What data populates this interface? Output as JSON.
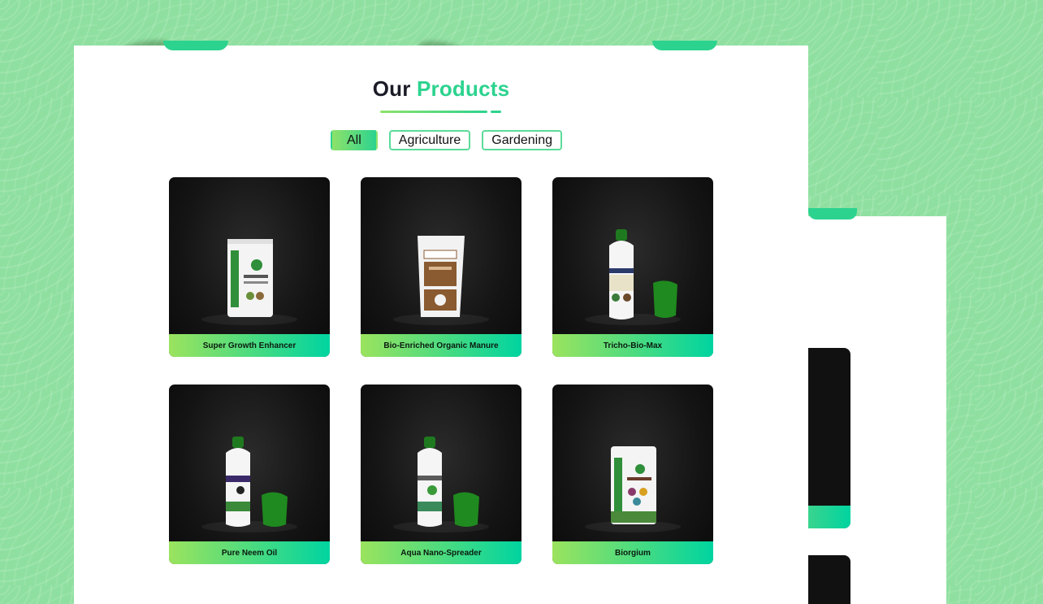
{
  "section": {
    "title_main": "Our",
    "title_highlight": "Products"
  },
  "filters": [
    {
      "label": "All",
      "active": true
    },
    {
      "label": "Agriculture",
      "active": false
    },
    {
      "label": "Gardening",
      "active": false
    }
  ],
  "products": [
    {
      "name": "Super Growth Enhancer",
      "image": "pouch"
    },
    {
      "name": "Bio-Enriched Organic Manure",
      "image": "sack"
    },
    {
      "name": "Tricho-Bio-Max",
      "image": "bottle"
    },
    {
      "name": "Pure Neem Oil",
      "image": "bottle"
    },
    {
      "name": "Aqua Nano-Spreader",
      "image": "bottle"
    },
    {
      "name": "Biorgium",
      "image": "pouch"
    }
  ],
  "colors": {
    "accent": "#2cd38f",
    "accent_light": "#9be35e",
    "background": "#8fe0a0"
  }
}
